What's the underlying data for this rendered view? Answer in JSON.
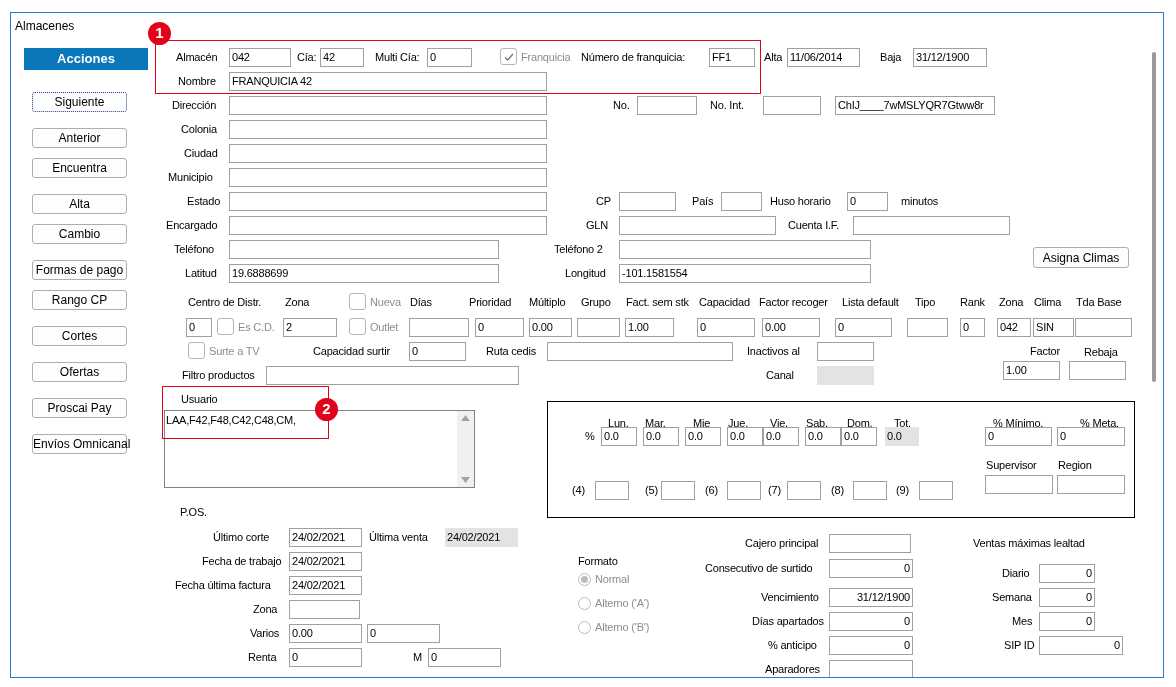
{
  "window": {
    "title": "Almacenes"
  },
  "actions": {
    "header": "Acciones",
    "buttons": [
      {
        "label": "Siguiente",
        "focused": true
      },
      {
        "label": "Anterior",
        "focused": false
      },
      {
        "label": "Encuentra",
        "focused": false
      },
      {
        "label": "Alta",
        "focused": false
      },
      {
        "label": "Cambio",
        "focused": false
      },
      {
        "label": "Formas de pago",
        "focused": false
      },
      {
        "label": "Rango CP",
        "focused": false
      },
      {
        "label": "Cortes",
        "focused": false
      },
      {
        "label": "Ofertas",
        "focused": false
      },
      {
        "label": "Proscai Pay",
        "focused": false
      },
      {
        "label": "Envíos Omnicanal",
        "focused": false
      }
    ]
  },
  "callouts": [
    {
      "number": "1"
    },
    {
      "number": "2"
    }
  ],
  "form": {
    "controls": [
      {
        "kind": "label",
        "text": "Almacén"
      },
      {
        "kind": "field",
        "value": "042",
        "disabled": false
      },
      {
        "kind": "label",
        "text": "Cía:"
      },
      {
        "kind": "field",
        "value": "42",
        "disabled": false
      },
      {
        "kind": "label",
        "text": "Multi Cía:"
      },
      {
        "kind": "field",
        "value": "0",
        "disabled": false
      },
      {
        "kind": "checkbox",
        "text": "Franquicia",
        "checked": true,
        "disabled": true
      },
      {
        "kind": "label",
        "text": "Número de franquicia:"
      },
      {
        "kind": "field",
        "value": "FF1",
        "disabled": false
      },
      {
        "kind": "label",
        "text": "Alta"
      },
      {
        "kind": "field",
        "value": "11/06/2014",
        "disabled": false
      },
      {
        "kind": "label",
        "text": "Baja"
      },
      {
        "kind": "field",
        "value": "31/12/1900",
        "disabled": false
      },
      {
        "kind": "label",
        "text": "Nombre"
      },
      {
        "kind": "field",
        "value": "FRANQUICIA 42",
        "disabled": false
      },
      {
        "kind": "label",
        "text": "Dirección"
      },
      {
        "kind": "field",
        "disabled": false
      },
      {
        "kind": "label",
        "text": "No."
      },
      {
        "kind": "field",
        "disabled": false
      },
      {
        "kind": "label",
        "text": "No. Int."
      },
      {
        "kind": "field",
        "disabled": false
      },
      {
        "kind": "field",
        "value": "ChIJ____7wMSLYQR7Gtww8r",
        "disabled": false
      },
      {
        "kind": "label",
        "text": "Colonia"
      },
      {
        "kind": "field",
        "disabled": false
      },
      {
        "kind": "label",
        "text": "Ciudad"
      },
      {
        "kind": "field",
        "disabled": false
      },
      {
        "kind": "label",
        "text": "Municipio"
      },
      {
        "kind": "field",
        "disabled": false
      },
      {
        "kind": "label",
        "text": "Estado"
      },
      {
        "kind": "field",
        "disabled": false
      },
      {
        "kind": "label",
        "text": "CP"
      },
      {
        "kind": "field",
        "disabled": false
      },
      {
        "kind": "label",
        "text": "País"
      },
      {
        "kind": "field",
        "disabled": false
      },
      {
        "kind": "label",
        "text": "Huso horario"
      },
      {
        "kind": "field",
        "value": "0",
        "disabled": false
      },
      {
        "kind": "label",
        "text": "minutos"
      },
      {
        "kind": "label",
        "text": "Encargado"
      },
      {
        "kind": "field",
        "disabled": false
      },
      {
        "kind": "label",
        "text": "GLN"
      },
      {
        "kind": "field",
        "disabled": false
      },
      {
        "kind": "label",
        "text": "Cuenta I.F."
      },
      {
        "kind": "field",
        "disabled": false
      },
      {
        "kind": "label",
        "text": "Teléfono"
      },
      {
        "kind": "field",
        "disabled": false
      },
      {
        "kind": "label",
        "text": "Teléfono 2"
      },
      {
        "kind": "field",
        "disabled": false
      },
      {
        "kind": "button",
        "text": "Asigna Climas"
      },
      {
        "kind": "label",
        "text": "Latitud"
      },
      {
        "kind": "field",
        "value": "19.6888699",
        "disabled": false
      },
      {
        "kind": "label",
        "text": "Longitud"
      },
      {
        "kind": "field",
        "value": "-101.1581554",
        "disabled": false
      },
      {
        "kind": "label",
        "text": "Centro de Distr."
      },
      {
        "kind": "label",
        "text": "Zona"
      },
      {
        "kind": "checkbox",
        "text": "Nueva",
        "checked": false,
        "disabled": true
      },
      {
        "kind": "label",
        "text": "Días"
      },
      {
        "kind": "label",
        "text": "Prioridad"
      },
      {
        "kind": "label",
        "text": "Múltiplo"
      },
      {
        "kind": "label",
        "text": "Grupo"
      },
      {
        "kind": "label",
        "text": "Fact. sem stk"
      },
      {
        "kind": "label",
        "text": "Capacidad"
      },
      {
        "kind": "label",
        "text": "Factor recoger"
      },
      {
        "kind": "label",
        "text": "Lista default"
      },
      {
        "kind": "label",
        "text": "Tipo"
      },
      {
        "kind": "label",
        "text": "Rank"
      },
      {
        "kind": "label",
        "text": "Zona"
      },
      {
        "kind": "label",
        "text": "Clima"
      },
      {
        "kind": "label",
        "text": "Tda Base"
      },
      {
        "kind": "field",
        "value": "0",
        "disabled": false
      },
      {
        "kind": "checkbox",
        "text": "Es C.D.",
        "checked": false,
        "disabled": true
      },
      {
        "kind": "field",
        "value": "2",
        "disabled": false
      },
      {
        "kind": "checkbox",
        "text": "Outlet",
        "checked": false,
        "disabled": true
      },
      {
        "kind": "field",
        "disabled": false
      },
      {
        "kind": "field",
        "value": "0",
        "disabled": false
      },
      {
        "kind": "field",
        "value": "0.00",
        "disabled": false
      },
      {
        "kind": "field",
        "disabled": false
      },
      {
        "kind": "field",
        "value": "1.00",
        "disabled": false
      },
      {
        "kind": "field",
        "value": "0",
        "disabled": false
      },
      {
        "kind": "field",
        "value": "0.00",
        "disabled": false
      },
      {
        "kind": "field",
        "value": "0",
        "disabled": false
      },
      {
        "kind": "field",
        "disabled": false
      },
      {
        "kind": "field",
        "value": "0",
        "disabled": false
      },
      {
        "kind": "field",
        "value": "042",
        "disabled": false
      },
      {
        "kind": "field",
        "value": "SIN",
        "disabled": false
      },
      {
        "kind": "field",
        "disabled": false
      },
      {
        "kind": "checkbox",
        "text": "Surte a TV",
        "checked": false,
        "disabled": true
      },
      {
        "kind": "label",
        "text": "Capacidad surtir"
      },
      {
        "kind": "field",
        "value": "0",
        "disabled": false
      },
      {
        "kind": "label",
        "text": "Ruta cedis"
      },
      {
        "kind": "field",
        "disabled": false
      },
      {
        "kind": "label",
        "text": "Inactivos al"
      },
      {
        "kind": "field",
        "disabled": false
      },
      {
        "kind": "label",
        "text": "Factor"
      },
      {
        "kind": "label",
        "text": "Rebaja"
      },
      {
        "kind": "label",
        "text": "Filtro productos"
      },
      {
        "kind": "field",
        "disabled": false
      },
      {
        "kind": "label",
        "text": "Canal"
      },
      {
        "kind": "field",
        "disabled": true
      },
      {
        "kind": "field",
        "value": "1.00",
        "disabled": false
      },
      {
        "kind": "field",
        "disabled": false
      },
      {
        "kind": "label",
        "text": "Usuario"
      },
      {
        "kind": "listbox",
        "value": "LAA,F42,F48,C42,C48,CM,"
      },
      {
        "kind": "label",
        "text": "%"
      },
      {
        "kind": "label",
        "text": "Lun."
      },
      {
        "kind": "label",
        "text": "Mar."
      },
      {
        "kind": "label",
        "text": "Mie"
      },
      {
        "kind": "label",
        "text": "Jue."
      },
      {
        "kind": "label",
        "text": "Vie."
      },
      {
        "kind": "label",
        "text": "Sab."
      },
      {
        "kind": "label",
        "text": "Dom."
      },
      {
        "kind": "label",
        "text": "Tot."
      },
      {
        "kind": "field",
        "value": "0.0",
        "disabled": false
      },
      {
        "kind": "field",
        "value": "0.0",
        "disabled": false
      },
      {
        "kind": "field",
        "value": "0.0",
        "disabled": false
      },
      {
        "kind": "field",
        "value": "0.0",
        "disabled": false
      },
      {
        "kind": "field",
        "value": "0.0",
        "disabled": false
      },
      {
        "kind": "field",
        "value": "0.0",
        "disabled": false
      },
      {
        "kind": "field",
        "value": "0.0",
        "disabled": false
      },
      {
        "kind": "field",
        "value": "0.0",
        "disabled": true
      },
      {
        "kind": "label",
        "text": "% Mínimo."
      },
      {
        "kind": "label",
        "text": "% Meta."
      },
      {
        "kind": "field",
        "value": "0",
        "disabled": false
      },
      {
        "kind": "field",
        "value": "0",
        "disabled": false
      },
      {
        "kind": "label",
        "text": "Supervisor"
      },
      {
        "kind": "label",
        "text": "Region"
      },
      {
        "kind": "field",
        "disabled": false
      },
      {
        "kind": "field",
        "disabled": false
      },
      {
        "kind": "label",
        "text": "(4)"
      },
      {
        "kind": "field",
        "disabled": false
      },
      {
        "kind": "label",
        "text": "(5)"
      },
      {
        "kind": "field",
        "disabled": false
      },
      {
        "kind": "label",
        "text": "(6)"
      },
      {
        "kind": "field",
        "disabled": false
      },
      {
        "kind": "label",
        "text": "(7)"
      },
      {
        "kind": "field",
        "disabled": false
      },
      {
        "kind": "label",
        "text": "(8)"
      },
      {
        "kind": "field",
        "disabled": false
      },
      {
        "kind": "label",
        "text": "(9)"
      },
      {
        "kind": "field",
        "disabled": false
      },
      {
        "kind": "label",
        "text": "P.OS."
      },
      {
        "kind": "label",
        "text": "Último corte"
      },
      {
        "kind": "field",
        "value": "24/02/2021",
        "disabled": false
      },
      {
        "kind": "label",
        "text": "Última venta"
      },
      {
        "kind": "field",
        "value": "24/02/2021",
        "disabled": true
      },
      {
        "kind": "label",
        "text": "Fecha de trabajo"
      },
      {
        "kind": "field",
        "value": "24/02/2021",
        "disabled": false
      },
      {
        "kind": "label",
        "text": "Fecha última factura"
      },
      {
        "kind": "field",
        "value": "24/02/2021",
        "disabled": false
      },
      {
        "kind": "label",
        "text": "Zona"
      },
      {
        "kind": "field",
        "disabled": false
      },
      {
        "kind": "label",
        "text": "Varios"
      },
      {
        "kind": "field",
        "value": "0.00",
        "disabled": false
      },
      {
        "kind": "field",
        "value": "0",
        "disabled": false
      },
      {
        "kind": "label",
        "text": "Renta"
      },
      {
        "kind": "field",
        "value": "0",
        "disabled": false
      },
      {
        "kind": "label",
        "text": "M"
      },
      {
        "kind": "field",
        "value": "0",
        "disabled": false
      },
      {
        "kind": "label",
        "text": "Formato"
      },
      {
        "kind": "radio",
        "text": "Normal",
        "selected": true,
        "disabled": true
      },
      {
        "kind": "radio",
        "text": "Alterno ('A')",
        "selected": false,
        "disabled": true
      },
      {
        "kind": "radio",
        "text": "Alterno ('B')",
        "selected": false,
        "disabled": true
      },
      {
        "kind": "label",
        "text": "Cajero principal"
      },
      {
        "kind": "field",
        "disabled": false
      },
      {
        "kind": "label",
        "text": "Consecutivo de surtido"
      },
      {
        "kind": "field",
        "value": "0",
        "disabled": false
      },
      {
        "kind": "label",
        "text": "Vencimiento"
      },
      {
        "kind": "field",
        "value": "31/12/1900",
        "disabled": false
      },
      {
        "kind": "label",
        "text": "Días apartados"
      },
      {
        "kind": "field",
        "value": "0",
        "disabled": false
      },
      {
        "kind": "label",
        "text": "% anticipo"
      },
      {
        "kind": "field",
        "value": "0",
        "disabled": false
      },
      {
        "kind": "label",
        "text": "Aparadores"
      },
      {
        "kind": "field",
        "disabled": false
      },
      {
        "kind": "label",
        "text": "Ventas máximas lealtad"
      },
      {
        "kind": "label",
        "text": "Diario"
      },
      {
        "kind": "field",
        "value": "0",
        "disabled": false
      },
      {
        "kind": "label",
        "text": "Semana"
      },
      {
        "kind": "field",
        "value": "0",
        "disabled": false
      },
      {
        "kind": "label",
        "text": "Mes"
      },
      {
        "kind": "field",
        "value": "0",
        "disabled": false
      },
      {
        "kind": "label",
        "text": "SIP ID"
      },
      {
        "kind": "field",
        "value": "0",
        "disabled": false
      }
    ]
  }
}
